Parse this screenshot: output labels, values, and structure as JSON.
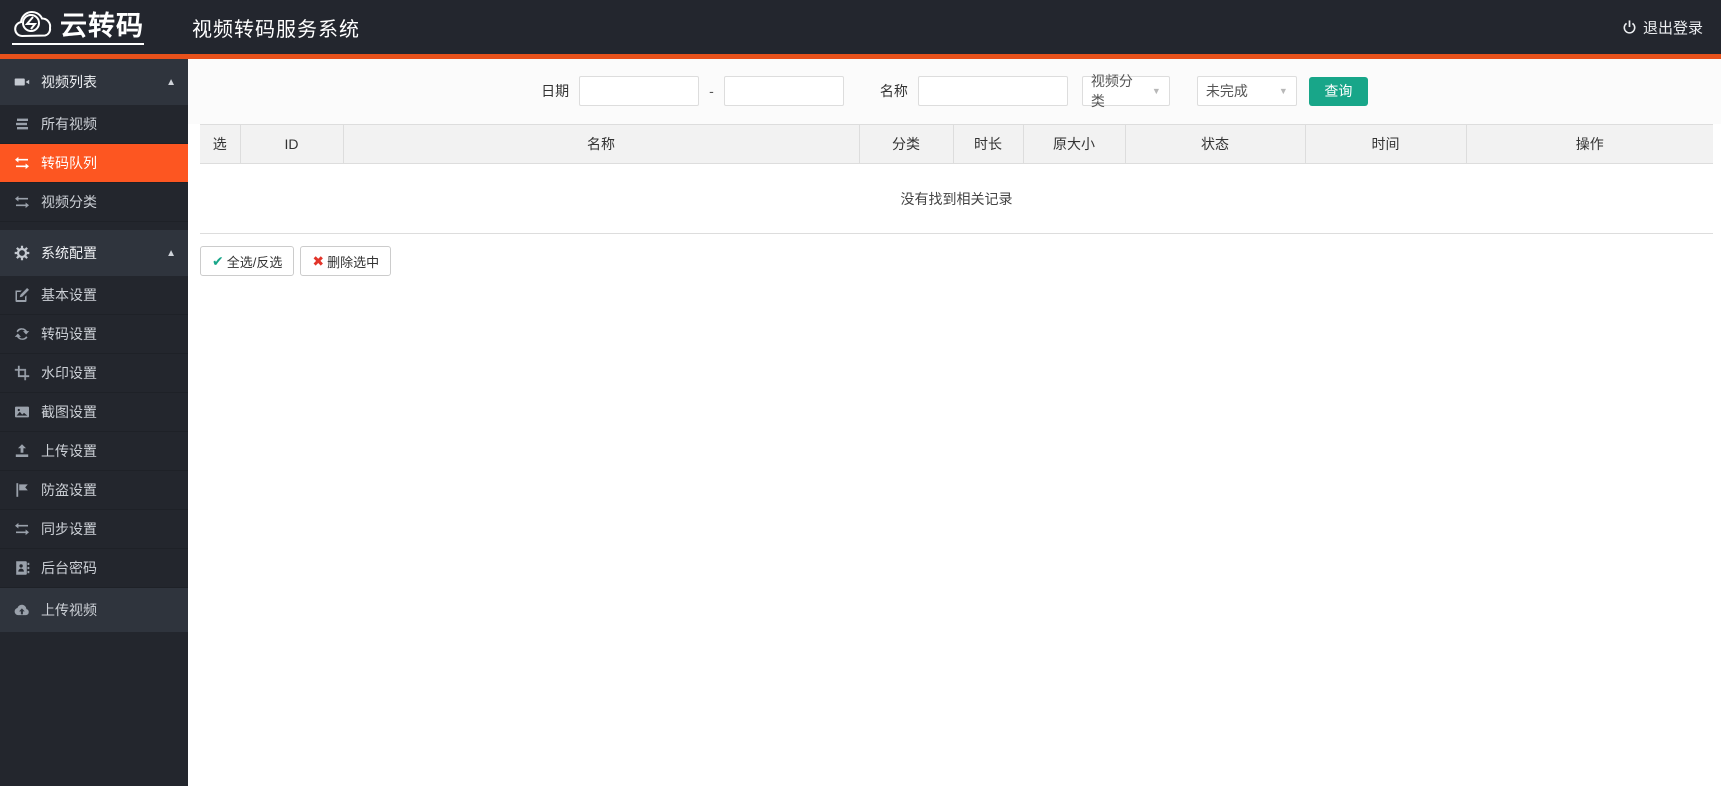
{
  "header": {
    "logo_text": "云转码",
    "title": "视频转码服务系统",
    "logout_label": "退出登录",
    "logout_icon": "power-icon"
  },
  "sidebar": {
    "sections": [
      {
        "label": "视频列表",
        "icon": "video-camera-icon",
        "items": [
          {
            "label": "所有视频",
            "icon": "list-icon",
            "active": false
          },
          {
            "label": "转码队列",
            "icon": "exchange-icon",
            "active": true
          },
          {
            "label": "视频分类",
            "icon": "exchange-icon",
            "active": false
          }
        ]
      },
      {
        "label": "系统配置",
        "icon": "gear-icon",
        "items": [
          {
            "label": "基本设置",
            "icon": "edit-icon",
            "active": false
          },
          {
            "label": "转码设置",
            "icon": "refresh-icon",
            "active": false
          },
          {
            "label": "水印设置",
            "icon": "crop-icon",
            "active": false
          },
          {
            "label": "截图设置",
            "icon": "image-icon",
            "active": false
          },
          {
            "label": "上传设置",
            "icon": "upload-icon",
            "active": false
          },
          {
            "label": "防盗设置",
            "icon": "flag-icon",
            "active": false
          },
          {
            "label": "同步设置",
            "icon": "exchange-icon",
            "active": false
          },
          {
            "label": "后台密码",
            "icon": "id-card-icon",
            "active": false
          }
        ]
      }
    ],
    "upload_item": {
      "label": "上传视频",
      "icon": "cloud-upload-icon"
    }
  },
  "filters": {
    "date_label": "日期",
    "date_from_value": "",
    "date_separator": "-",
    "date_to_value": "",
    "name_label": "名称",
    "name_value": "",
    "category_select_value": "视频分类",
    "status_select_value": "未完成",
    "search_button": "查询"
  },
  "table": {
    "columns": [
      "选",
      "ID",
      "名称",
      "分类",
      "时长",
      "原大小",
      "状态",
      "时间",
      "操作"
    ],
    "empty_message": "没有找到相关记录"
  },
  "actions": {
    "select_all_label": "全选/反选",
    "select_all_icon": "check-icon",
    "delete_selected_label": "删除选中",
    "delete_selected_icon": "cross-icon"
  },
  "colors": {
    "header_bg": "#23262e",
    "sidebar_bg": "#23262d",
    "sidebar_section_bg": "#2f343d",
    "accent_orange": "#fd5621",
    "header_underline_orange": "#e8511b",
    "search_button_teal": "#18a689",
    "check_green": "#18a689",
    "cross_red": "#e2342a",
    "table_header_bg": "#f2f2f2",
    "border_gray": "#dddddd"
  }
}
